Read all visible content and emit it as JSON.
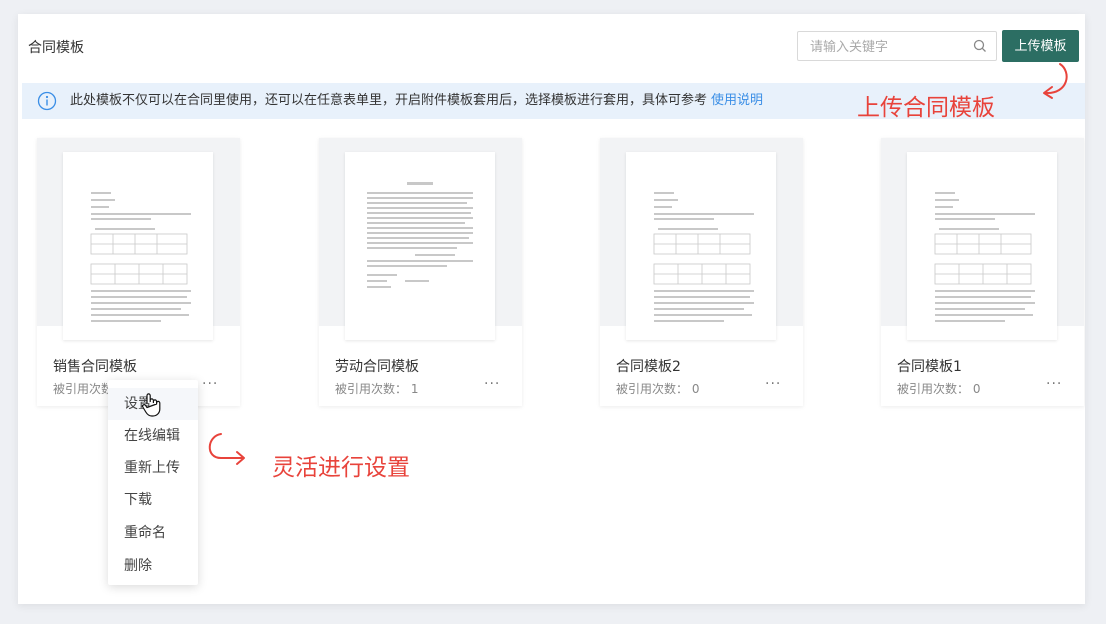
{
  "header": {
    "title": "合同模板",
    "search_placeholder": "请输入关键字",
    "upload_label": "上传模板"
  },
  "notice": {
    "text": "此处模板不仅可以在合同里使用，还可以在任意表单里，开启附件模板套用后，选择模板进行套用，具体可参考",
    "link": "使用说明"
  },
  "cards": [
    {
      "name": "销售合同模板",
      "usage": "被引用次数：",
      "more": "···"
    },
    {
      "name": "劳动合同模板",
      "usage": "被引用次数： 1",
      "more": "···"
    },
    {
      "name": "合同模板2",
      "usage": "被引用次数： 0",
      "more": "···"
    },
    {
      "name": "合同模板1",
      "usage": "被引用次数： 0",
      "more": "···"
    }
  ],
  "menu": {
    "items": [
      "设置",
      "在线编辑",
      "重新上传",
      "下载",
      "重命名",
      "删除"
    ]
  },
  "annotations": {
    "upload": "上传合同模板",
    "settings": "灵活进行设置"
  },
  "colors": {
    "primary": "#2c6e63",
    "link": "#3a8ee6",
    "annotation": "#e8433b",
    "notice_bg": "#e8f1fb"
  }
}
